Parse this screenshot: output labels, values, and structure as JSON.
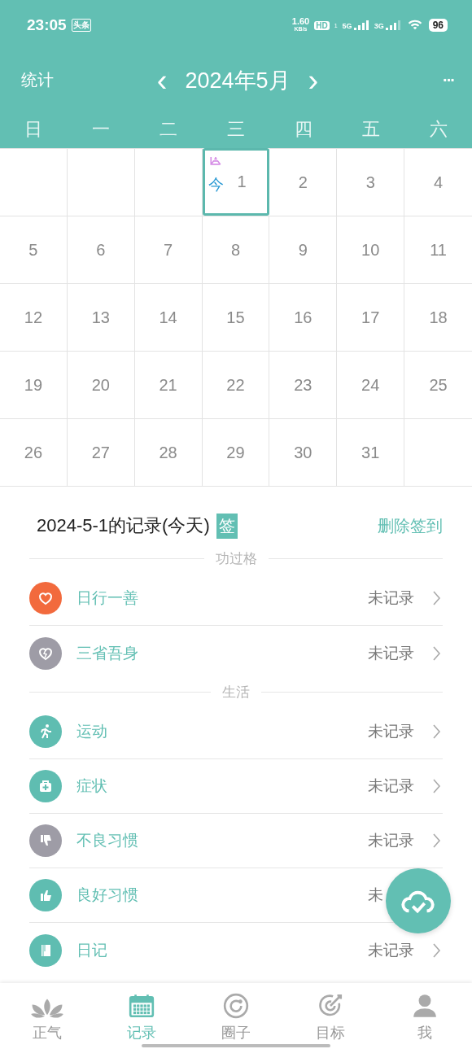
{
  "status_bar": {
    "time": "23:05",
    "badge": "头条",
    "speed": "1.60",
    "speed_unit": "KB/s",
    "hd": "HD",
    "hd_sub": "1",
    "net1": "5G",
    "net2": "3G",
    "battery": "96"
  },
  "header": {
    "left": "统计",
    "prev": "‹",
    "title": "2024年5月",
    "next": "›",
    "more": "···"
  },
  "weekdays": [
    "日",
    "一",
    "二",
    "三",
    "四",
    "五",
    "六"
  ],
  "calendar": [
    [
      {
        "selected": false
      },
      {
        "selected": false
      },
      {
        "selected": false
      },
      {
        "day": "1",
        "selected": true,
        "today_label": "今"
      },
      {
        "day": "2",
        "selected": false
      },
      {
        "day": "3",
        "selected": false
      },
      {
        "day": "4",
        "selected": false
      }
    ],
    [
      {
        "day": "5",
        "selected": false
      },
      {
        "day": "6",
        "selected": false
      },
      {
        "day": "7",
        "selected": false
      },
      {
        "day": "8",
        "selected": false
      },
      {
        "day": "9",
        "selected": false
      },
      {
        "day": "10",
        "selected": false
      },
      {
        "day": "11",
        "selected": false
      }
    ],
    [
      {
        "day": "12",
        "selected": false
      },
      {
        "day": "13",
        "selected": false
      },
      {
        "day": "14",
        "selected": false
      },
      {
        "day": "15",
        "selected": false
      },
      {
        "day": "16",
        "selected": false
      },
      {
        "day": "17",
        "selected": false
      },
      {
        "day": "18",
        "selected": false
      }
    ],
    [
      {
        "day": "19",
        "selected": false
      },
      {
        "day": "20",
        "selected": false
      },
      {
        "day": "21",
        "selected": false
      },
      {
        "day": "22",
        "selected": false
      },
      {
        "day": "23",
        "selected": false
      },
      {
        "day": "24",
        "selected": false
      },
      {
        "day": "25",
        "selected": false
      }
    ],
    [
      {
        "day": "26",
        "selected": false
      },
      {
        "day": "27",
        "selected": false
      },
      {
        "day": "28",
        "selected": false
      },
      {
        "day": "29",
        "selected": false
      },
      {
        "day": "30",
        "selected": false
      },
      {
        "day": "31",
        "selected": false
      },
      {
        "selected": false
      }
    ]
  ],
  "record": {
    "title": "2024-5-1的记录(今天)",
    "sign_badge": "签",
    "action": "删除签到"
  },
  "groups": [
    {
      "title": "功过格",
      "items": [
        {
          "kind": "heart",
          "color": "#f26a3d",
          "name": "日行一善",
          "status": "未记录",
          "chevron": true
        },
        {
          "kind": "broken-heart",
          "color": "#9e9ca6",
          "name": "三省吾身",
          "status": "未记录",
          "chevron": true
        }
      ]
    },
    {
      "title": "生活",
      "items": [
        {
          "kind": "run",
          "color": "#5fbdb1",
          "name": "运动",
          "status": "未记录",
          "chevron": true
        },
        {
          "kind": "medkit",
          "color": "#5fbdb1",
          "name": "症状",
          "status": "未记录",
          "chevron": true
        },
        {
          "kind": "thumb-down",
          "color": "#9e9ca6",
          "name": "不良习惯",
          "status": "未记录",
          "chevron": true
        },
        {
          "kind": "thumb-up",
          "color": "#5fbdb1",
          "name": "良好习惯",
          "status": "未",
          "chevron": false
        },
        {
          "kind": "book",
          "color": "#5fbdb1",
          "name": "日记",
          "status": "未记录",
          "chevron": true
        }
      ]
    }
  ],
  "nav": [
    {
      "kind": "lotus",
      "label": "正气",
      "selected": false
    },
    {
      "kind": "calendar",
      "label": "记录",
      "selected": true
    },
    {
      "kind": "circle",
      "label": "圈子",
      "selected": false
    },
    {
      "kind": "target",
      "label": "目标",
      "selected": false
    },
    {
      "kind": "person",
      "label": "我",
      "selected": false
    }
  ]
}
